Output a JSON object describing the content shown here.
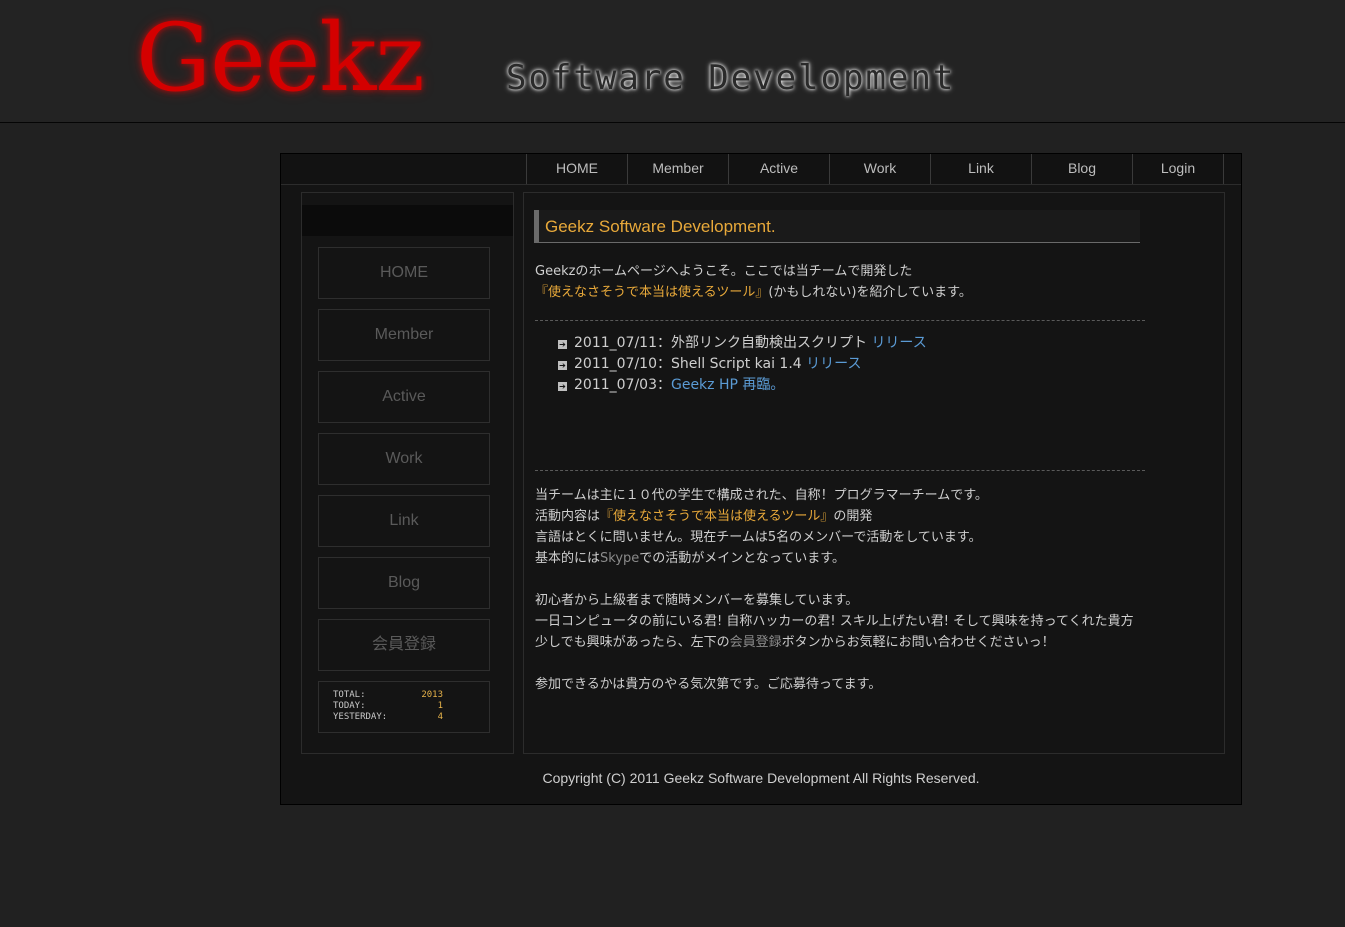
{
  "header": {
    "logo": "Geekz",
    "tagline": "Software Development"
  },
  "nav": [
    {
      "label": "HOME"
    },
    {
      "label": "Member"
    },
    {
      "label": "Active"
    },
    {
      "label": "Work"
    },
    {
      "label": "Link"
    },
    {
      "label": "Blog"
    },
    {
      "label": "Login"
    }
  ],
  "sidebar": {
    "buttons": [
      {
        "label": "HOME"
      },
      {
        "label": "Member"
      },
      {
        "label": "Active"
      },
      {
        "label": "Work"
      },
      {
        "label": "Link"
      },
      {
        "label": "Blog"
      },
      {
        "label": "会員登録"
      }
    ],
    "counter": {
      "total_label": "TOTAL:",
      "total": "2013",
      "today_label": "TODAY:",
      "today": "1",
      "yesterday_label": "YESTERDAY:",
      "yesterday": "4"
    }
  },
  "main": {
    "title": "Geekz Software Development.",
    "intro_line1": "Geekzのホームページへようこそ。ここでは当チームで開発した",
    "intro_highlight": "『使えなさそうで本当は使えるツール』",
    "intro_line2_rest": "(かもしれない)を紹介しています。",
    "news": [
      {
        "date": "2011_07/11：",
        "text": "外部リンク自動検出スクリプト ",
        "link": "リリース"
      },
      {
        "date": "2011_07/10：",
        "text": "Shell Script kai 1.4 ",
        "link": "リリース"
      },
      {
        "date": "2011_07/03：",
        "text": "",
        "link": "Geekz HP 再臨。"
      }
    ],
    "about": {
      "l1": "当チームは主に１０代の学生で構成された、自称！プログラマーチームです。",
      "l2_pre": "活動内容は",
      "l2_highlight": "『使えなさそうで本当は使えるツール』",
      "l2_post": "の開発",
      "l3": "言語はとくに問いません。現在チームは5名のメンバーで活動をしています。",
      "l4_pre": "基本的には",
      "l4_gray": "Skype",
      "l4_post": "での活動がメインとなっています。",
      "l5": "初心者から上級者まで随時メンバーを募集しています。",
      "l6": "一日コンピュータの前にいる君! 自称ハッカーの君! スキル上げたい君! そして興味を持ってくれた貴方",
      "l7_pre": "少しでも興味があったら、左下の",
      "l7_gray": "会員登録",
      "l7_post": "ボタンからお気軽にお問い合わせくださいっ！",
      "l8": "参加できるかは貴方のやる気次第です。ご応募待ってます。"
    }
  },
  "footer": {
    "copyright": "Copyright (C) 2011 Geekz Software Development All Rights Reserved."
  }
}
